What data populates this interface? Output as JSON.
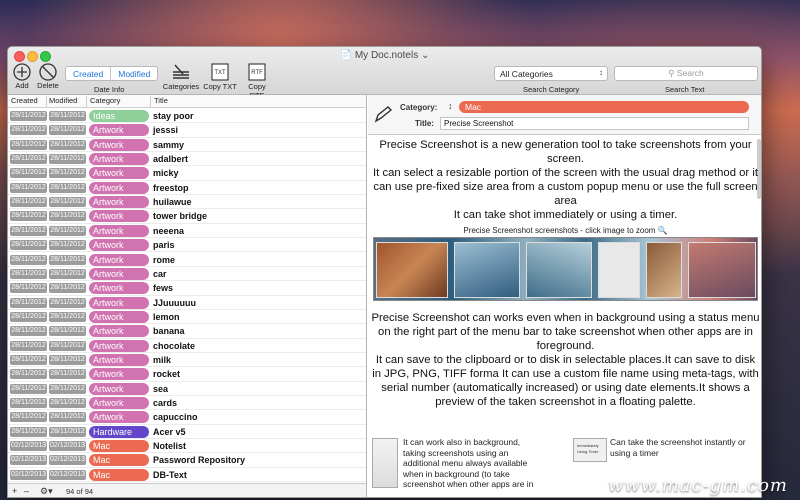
{
  "window": {
    "title": "My Doc.notels"
  },
  "toolbar": {
    "add_label": "Add",
    "delete_label": "Delete",
    "seg_created": "Created",
    "seg_modified": "Modified",
    "date_info_label": "Date Info",
    "categories_label": "Categories",
    "copy_txt_label": "Copy TXT",
    "copy_rtf_label": "Copy RTF",
    "category_select_value": "All Categories",
    "search_category_label": "Search Category",
    "search_placeholder": "Search",
    "search_text_label": "Search Text",
    "txt_icon_text": "TXT",
    "rtf_icon_text": "RTF"
  },
  "list": {
    "columns": [
      "Created",
      "Modified",
      "Category",
      "Title"
    ],
    "rows": [
      {
        "created": "28/11/2012",
        "modified": "28/11/2012",
        "category": "Ideas",
        "title": "stay poor"
      },
      {
        "created": "28/11/2012",
        "modified": "28/11/2012",
        "category": "Artwork",
        "title": "jesssi"
      },
      {
        "created": "28/11/2012",
        "modified": "28/11/2012",
        "category": "Artwork",
        "title": "sammy"
      },
      {
        "created": "28/11/2012",
        "modified": "28/11/2012",
        "category": "Artwork",
        "title": "adalbert"
      },
      {
        "created": "28/11/2012",
        "modified": "28/11/2012",
        "category": "Artwork",
        "title": "micky"
      },
      {
        "created": "28/11/2012",
        "modified": "28/11/2012",
        "category": "Artwork",
        "title": "freestop"
      },
      {
        "created": "28/11/2012",
        "modified": "28/11/2012",
        "category": "Artwork",
        "title": "huilawue"
      },
      {
        "created": "28/11/2012",
        "modified": "28/11/2012",
        "category": "Artwork",
        "title": "tower bridge"
      },
      {
        "created": "28/11/2012",
        "modified": "28/11/2012",
        "category": "Artwork",
        "title": "neeena"
      },
      {
        "created": "28/11/2012",
        "modified": "28/11/2012",
        "category": "Artwork",
        "title": "paris"
      },
      {
        "created": "28/11/2012",
        "modified": "28/11/2012",
        "category": "Artwork",
        "title": "rome"
      },
      {
        "created": "28/11/2012",
        "modified": "28/11/2012",
        "category": "Artwork",
        "title": "car"
      },
      {
        "created": "28/11/2012",
        "modified": "28/11/2012",
        "category": "Artwork",
        "title": "fews"
      },
      {
        "created": "28/11/2012",
        "modified": "28/11/2012",
        "category": "Artwork",
        "title": "JJuuuuuu"
      },
      {
        "created": "28/11/2012",
        "modified": "28/11/2012",
        "category": "Artwork",
        "title": "lemon"
      },
      {
        "created": "28/11/2012",
        "modified": "28/11/2012",
        "category": "Artwork",
        "title": "banana"
      },
      {
        "created": "28/11/2012",
        "modified": "28/11/2012",
        "category": "Artwork",
        "title": "chocolate"
      },
      {
        "created": "28/11/2012",
        "modified": "28/11/2012",
        "category": "Artwork",
        "title": "milk"
      },
      {
        "created": "28/11/2012",
        "modified": "28/11/2012",
        "category": "Artwork",
        "title": "rocket"
      },
      {
        "created": "28/11/2012",
        "modified": "28/11/2012",
        "category": "Artwork",
        "title": "sea"
      },
      {
        "created": "28/11/2012",
        "modified": "28/11/2012",
        "category": "Artwork",
        "title": "cards"
      },
      {
        "created": "28/11/2012",
        "modified": "28/11/2012",
        "category": "Artwork",
        "title": "capuccino"
      },
      {
        "created": "28/11/2012",
        "modified": "28/11/2012",
        "category": "Hardware",
        "title": "Acer v5"
      },
      {
        "created": "02/12/2013",
        "modified": "02/12/2013",
        "category": "Mac",
        "title": "Notelist"
      },
      {
        "created": "02/12/2013",
        "modified": "02/12/2013",
        "category": "Mac",
        "title": "Password Repository"
      },
      {
        "created": "02/12/2013",
        "modified": "02/12/2013",
        "category": "Mac",
        "title": "DB-Text"
      }
    ],
    "count_text": "94 of 94"
  },
  "category_colors": {
    "Ideas": "#8fcf9a",
    "Artwork": "#d073b0",
    "Hardware": "#6347c8",
    "Mac": "#ec6a52"
  },
  "editor": {
    "category_label": "Category:",
    "category_value": "Mac",
    "title_label": "Title:",
    "title_value": "Precise Screenshot",
    "para1": "Precise Screenshot is a new generation tool to take screenshots from your screen.",
    "para2": "It can select a resizable portion of the screen with the usual drag method or it can use pre-fixed size area from a custom popup menu or use the full screen area",
    "para3": "It can take shot immediately or using a timer.",
    "gallery_caption": "Precise Screenshot screenshots - click image to zoom",
    "para4": "Precise Screenshot can works even when in background using a status menu on the right part of the menu bar to take screenshot when other apps are in foreground.",
    "para5": "It can save to the clipboard or to disk in selectable places.It can save to disk in JPG, PNG, TIFF forma It can use a custom file name using meta-tags, with serial number (automatically increased) or using date elements.It shows a preview of the taken screenshot in a floating palette.",
    "feature1": "It can work also in background, taking screenshots using an additional menu always available when in background (to take screenshot when other apps are in",
    "feature2": "Can take the screenshot instantly or using a timer",
    "thumb2_line1": "Immediately",
    "thumb2_line2": "Using Timer"
  },
  "watermark": "www.mac-gm.com"
}
